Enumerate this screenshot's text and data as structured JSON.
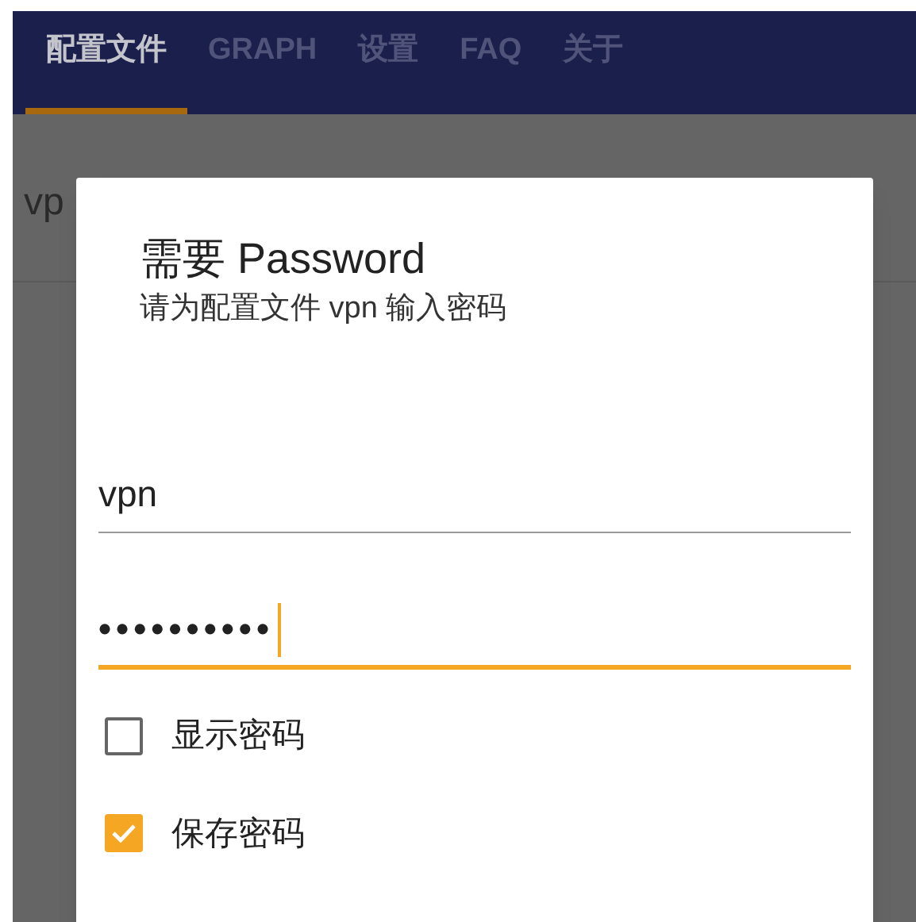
{
  "tabs": [
    {
      "label": "配置文件",
      "selected": true
    },
    {
      "label": "GRAPH",
      "selected": false
    },
    {
      "label": "设置",
      "selected": false
    },
    {
      "label": "FAQ",
      "selected": false
    },
    {
      "label": "关于",
      "selected": false
    }
  ],
  "background_list": {
    "items": [
      "vp"
    ]
  },
  "dialog": {
    "title": "需要 Password",
    "message": "请为配置文件 vpn 输入密码",
    "fields": [
      {
        "kind": "text",
        "value": "vpn",
        "focused": false
      },
      {
        "kind": "password",
        "value": "••••••••••",
        "focused": true
      }
    ],
    "checkboxes": [
      {
        "label": "显示密码",
        "checked": false
      },
      {
        "label": "保存密码",
        "checked": true
      }
    ]
  }
}
